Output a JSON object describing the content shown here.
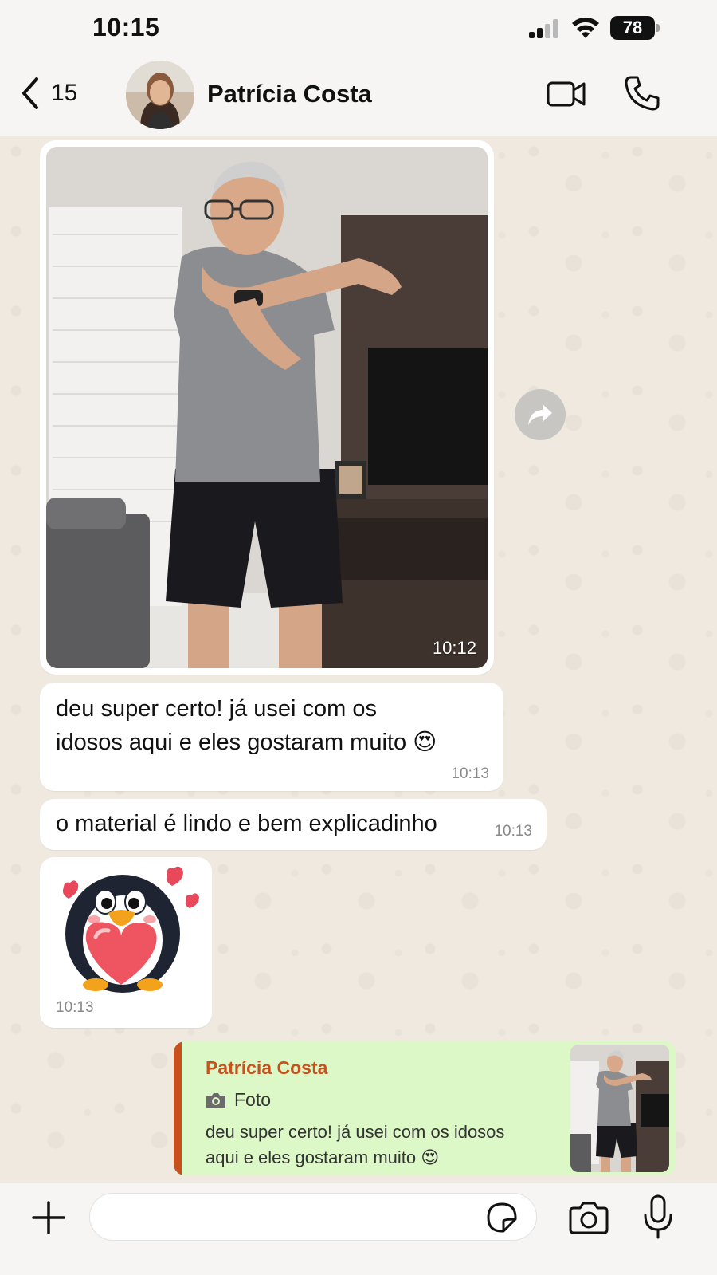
{
  "status_bar": {
    "time": "10:15",
    "battery": "78"
  },
  "header": {
    "back_count": "15",
    "contact_name": "Patrícia Costa"
  },
  "messages": [
    {
      "type": "photo",
      "time": "10:12"
    },
    {
      "type": "text",
      "text_line1": "deu super certo! já usei com os",
      "text_line2": "idosos aqui e eles gostaram muito 😍",
      "time": "10:13"
    },
    {
      "type": "text",
      "text": "o material é lindo e bem explicadinho",
      "time": "10:13"
    },
    {
      "type": "sticker",
      "time": "10:13"
    }
  ],
  "reply_preview": {
    "sender": "Patrícia Costa",
    "media_type": "Foto",
    "text_line1": "deu super certo! já usei com os idosos",
    "text_line2": "aqui e eles gostaram muito 😍"
  },
  "input": {
    "value": "",
    "placeholder": ""
  },
  "colors": {
    "reply_accent": "#c8501c",
    "reply_bg": "#dcf8c6",
    "bubble_bg": "#ffffff",
    "wallpaper": "#efe9e0"
  }
}
